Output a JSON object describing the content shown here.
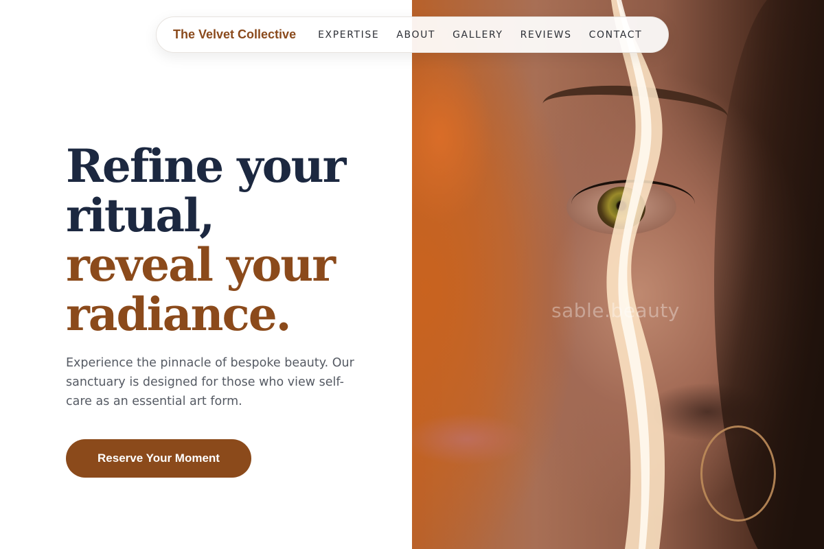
{
  "nav": {
    "brand": "The Velvet Collective",
    "links": [
      "EXPERTISE",
      "ABOUT",
      "GALLERY",
      "REVIEWS",
      "CONTACT"
    ]
  },
  "hero": {
    "headline_dark": [
      "Refine your",
      "ritual,"
    ],
    "headline_accent": [
      "reveal your",
      "radiance."
    ],
    "subtext": "Experience the pinnacle of bespoke beauty. Our sanctuary is designed for those who view self-care as an essential art form.",
    "cta_label": "Reserve Your Moment"
  },
  "photo": {
    "watermark": "sable.beauty"
  },
  "colors": {
    "accent": "#8b4a1b",
    "heading": "#1c2840",
    "body_text": "#555a63"
  }
}
